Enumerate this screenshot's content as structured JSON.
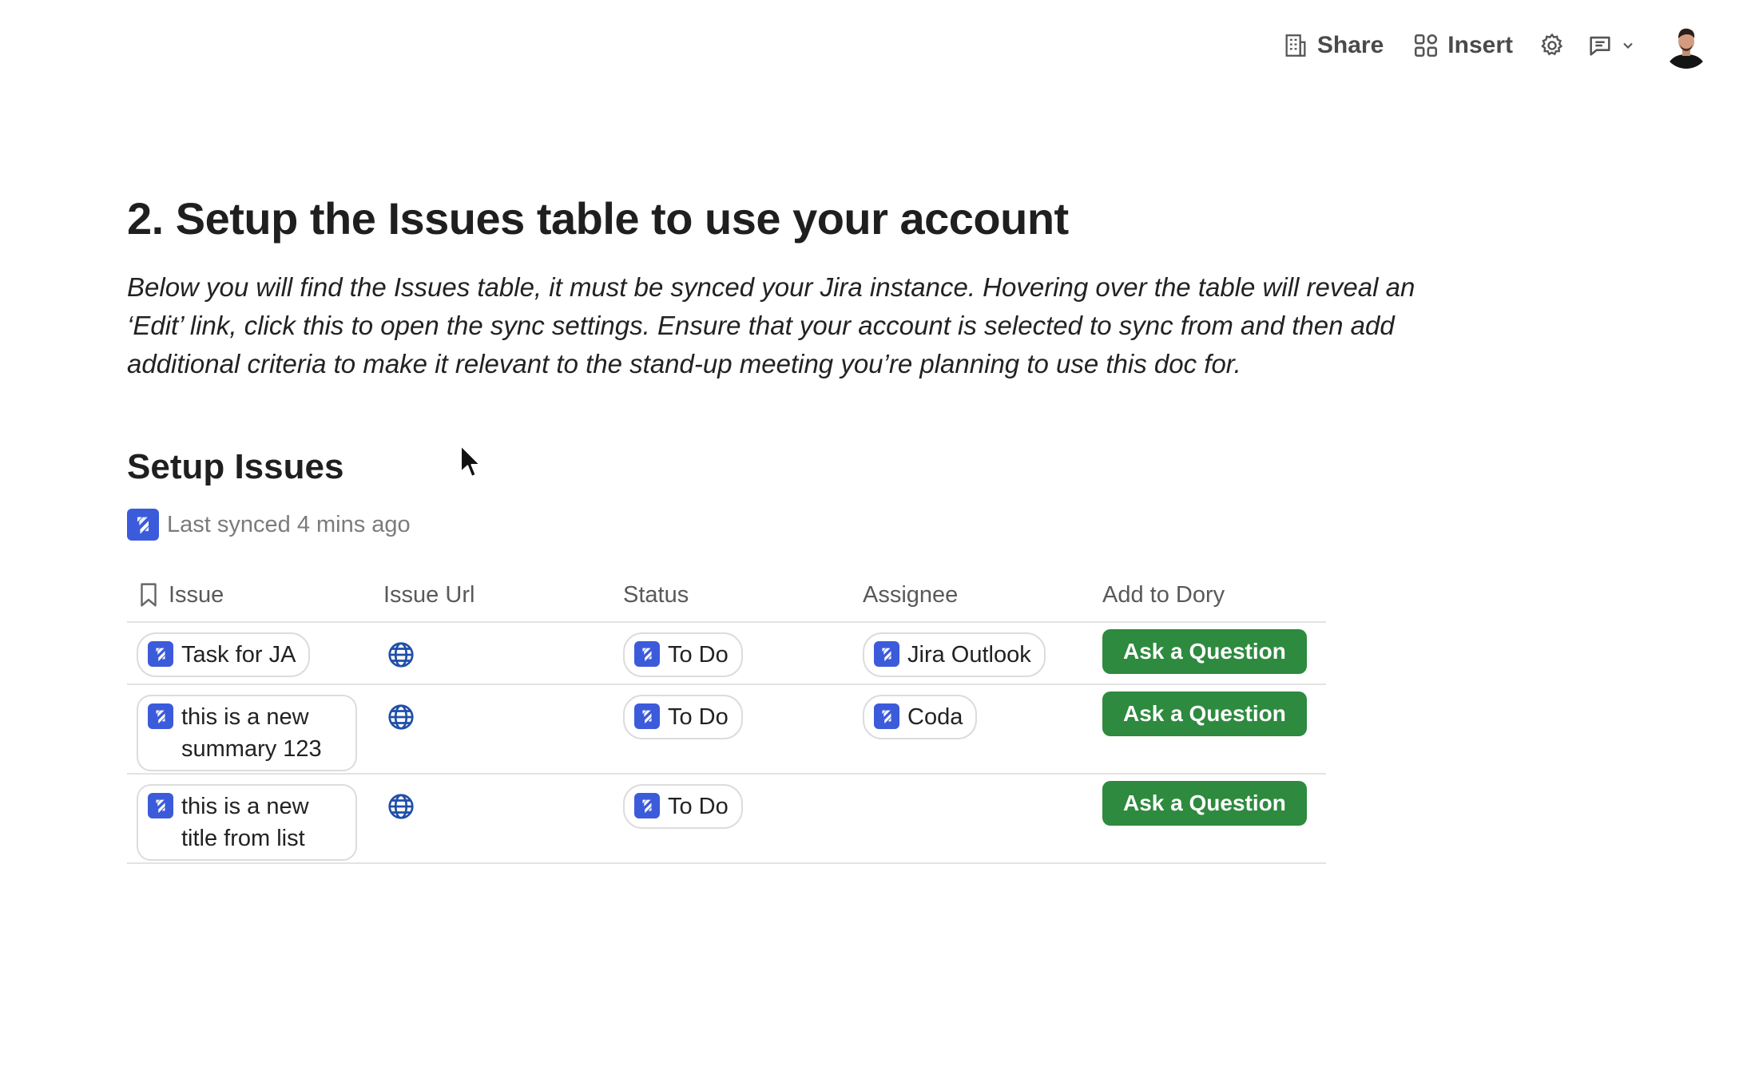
{
  "toolbar": {
    "share_label": "Share",
    "insert_label": "Insert"
  },
  "page": {
    "title": "2. Setup the Issues table to use your account",
    "intro": "Below you will find the Issues table, it must be synced your Jira instance. Hovering over the table will reveal an ‘Edit’ link, click this to open the sync settings. Ensure that your account is selected to sync from and then add additional criteria to make it relevant to the stand-up meeting you’re planning to use this doc for."
  },
  "section": {
    "title": "Setup Issues",
    "sync_status": "Last synced 4 mins ago"
  },
  "table": {
    "headers": [
      "Issue",
      "Issue Url",
      "Status",
      "Assignee",
      "Add to Dory"
    ],
    "rows": [
      {
        "issue": "Task for JA",
        "status": "To Do",
        "assignee": "Jira Outlook",
        "action": "Ask a Question"
      },
      {
        "issue": "this is a new summary 123",
        "status": "To Do",
        "assignee": "Coda",
        "action": "Ask a Question"
      },
      {
        "issue": "this is a new title from list",
        "status": "To Do",
        "assignee": "",
        "action": "Ask a Question"
      }
    ]
  },
  "colors": {
    "accent_green": "#2d8a3e",
    "jira_blue": "#3b5bdb",
    "globe_blue": "#1f4fa8"
  },
  "icons": [
    "building-icon",
    "grid-icon",
    "gear-icon",
    "comment-icon",
    "chevron-down-icon",
    "avatar",
    "jira-icon",
    "bookmark-icon",
    "globe-icon",
    "mouse-cursor"
  ]
}
